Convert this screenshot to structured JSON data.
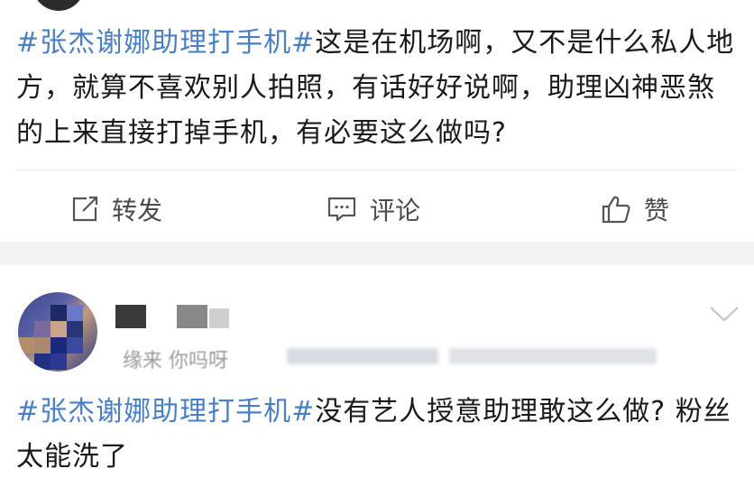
{
  "post1": {
    "hashtag": "#张杰谢娜助理打手机#",
    "text": "这是在机场啊，又不是什么私人地方，就算不喜欢别人拍照，有话好好说啊，助理凶神恶煞的上来直接打掉手机，有必要这么做吗?"
  },
  "actions": {
    "repost_label": "转发",
    "comment_label": "评论",
    "like_label": "赞"
  },
  "post2": {
    "meta_text": "缘来   你吗呀",
    "hashtag": "#张杰谢娜助理打手机#",
    "text": "没有艺人授意助理敢这么做? 粉丝太能洗了"
  },
  "colors": {
    "hashtag": "#4a7fc4",
    "text": "#1a1a1a",
    "action": "#4a4a4a",
    "background": "#f2f2f2"
  },
  "icons": [
    "repost-icon",
    "comment-icon",
    "like-icon",
    "chevron-down-icon"
  ]
}
